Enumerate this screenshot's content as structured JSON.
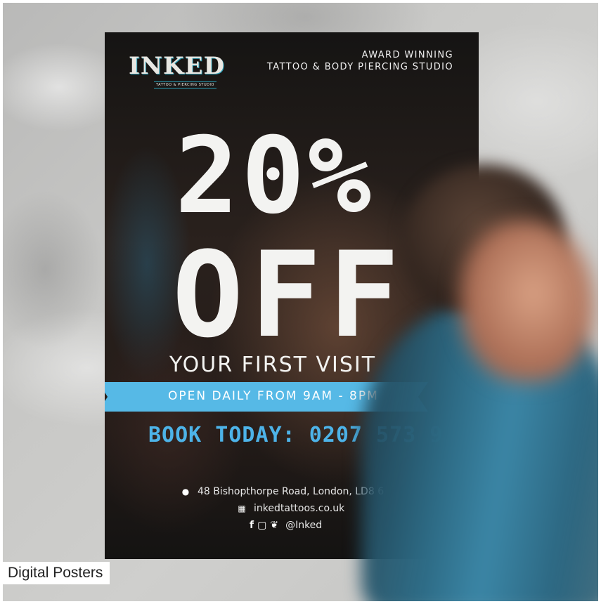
{
  "poster": {
    "logo_word": "INKED",
    "logo_sub": "TATTOO & PIERCING STUDIO",
    "award_line1": "AWARD WINNING",
    "award_line2": "TATTOO & BODY PIERCING STUDIO",
    "discount": "20%",
    "off": "OFF",
    "offer_line": "YOUR FIRST VISIT",
    "hours": "OPEN DAILY FROM 9AM - 8PM",
    "book": "BOOK TODAY: 0207 573 9",
    "address": "48 Bishopthorpe Road, London, LD8 6",
    "website": "inkedtattoos.co.uk",
    "social_handle": "@Inked"
  },
  "icons": {
    "location": "map-pin-icon",
    "website": "globe-icon",
    "social": [
      "facebook-icon",
      "instagram-icon",
      "twitter-icon"
    ]
  },
  "caption": "Digital Posters",
  "colors": {
    "accent_blue": "#56b9e6",
    "book_blue": "#4db3e8"
  }
}
